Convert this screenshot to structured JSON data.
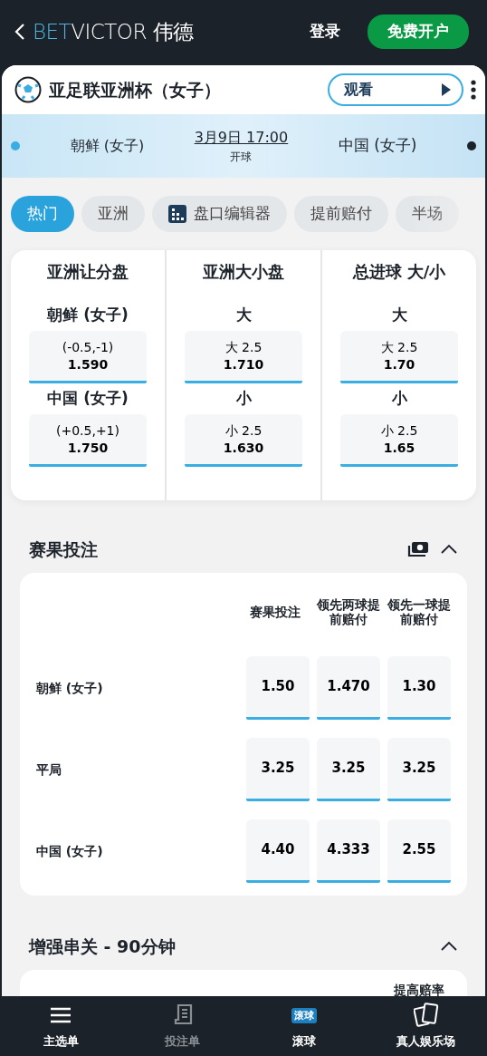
{
  "header": {
    "logo": {
      "bet": "BET",
      "victor": "VICTOR",
      "cn": "伟德"
    },
    "login": "登录",
    "signup": "免费开户"
  },
  "event": {
    "title": "亚足联亚洲杯（女子）",
    "watch": "观看"
  },
  "match": {
    "home": {
      "name": "朝鲜 (女子)",
      "color": "#3aaee0"
    },
    "away": {
      "name": "中国 (女子)",
      "color": "#1c2229"
    },
    "time": "3月9日 17:00",
    "status": "开球"
  },
  "tabs": [
    {
      "label": "热门",
      "kind": "plain",
      "selected": true
    },
    {
      "label": "亚洲",
      "kind": "plain",
      "selected": false
    },
    {
      "label": "盘口编辑器",
      "kind": "builder",
      "selected": false
    },
    {
      "label": "提前赔付",
      "kind": "plain",
      "selected": false
    },
    {
      "label": "半场",
      "kind": "plain",
      "selected": false
    }
  ],
  "markets": [
    {
      "title": "亚洲让分盘",
      "rows": [
        {
          "label": "朝鲜 (女子)",
          "line": "(-0.5,-1)",
          "odds": "1.590"
        },
        {
          "label": "中国 (女子)",
          "line": "(+0.5,+1)",
          "odds": "1.750"
        }
      ]
    },
    {
      "title": "亚洲大小盘",
      "rows": [
        {
          "label": "大",
          "line": "大 2.5",
          "odds": "1.710"
        },
        {
          "label": "小",
          "line": "小 2.5",
          "odds": "1.630"
        }
      ]
    },
    {
      "title": "总进球 大/小",
      "rows": [
        {
          "label": "大",
          "line": "大 2.5",
          "odds": "1.70"
        },
        {
          "label": "小",
          "line": "小 2.5",
          "odds": "1.65"
        }
      ]
    }
  ],
  "results": {
    "title": "赛果投注",
    "expanded": true,
    "columns": [
      "赛果投注",
      "领先两球提前赔付",
      "领先一球提前赔付"
    ],
    "rows": [
      {
        "label": "朝鲜 (女子)",
        "odds": [
          "1.50",
          "1.470",
          "1.30"
        ]
      },
      {
        "label": "平局",
        "odds": [
          "3.25",
          "3.25",
          "3.25"
        ]
      },
      {
        "label": "中国 (女子)",
        "odds": [
          "4.40",
          "4.333",
          "2.55"
        ]
      }
    ]
  },
  "boost": {
    "title": "增强串关 - 90分钟",
    "expanded": true,
    "column": "提高赔率"
  },
  "nav": [
    {
      "label": "主选单",
      "kind": "menu",
      "disabled": false
    },
    {
      "label": "投注单",
      "kind": "slip",
      "disabled": true
    },
    {
      "label": "滚球",
      "kind": "live",
      "badge": "滚球",
      "disabled": false
    },
    {
      "label": "真人娱乐场",
      "kind": "cards",
      "disabled": false
    }
  ]
}
